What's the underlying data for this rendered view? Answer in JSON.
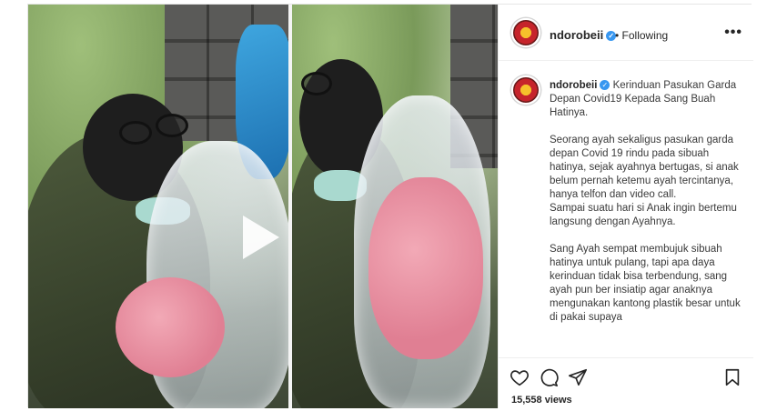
{
  "post": {
    "username": "ndorobeii",
    "follow_status": "• Following",
    "more_label": "•••",
    "caption": {
      "title": "Kerinduan Pasukan Garda Depan Covid19 Kepada Sang Buah Hatinya.",
      "paragraph1": "Seorang ayah sekaligus pasukan garda depan Covid 19 rindu pada sibuah hatinya, sejak ayahnya bertugas, si anak belum pernah ketemu ayah tercintanya, hanya telfon dan video call.",
      "paragraph2": "Sampai suatu hari si Anak ingin bertemu langsung dengan Ayahnya.",
      "paragraph3": "Sang Ayah sempat membujuk sibuah hatinya untuk pulang, tapi apa daya kerinduan tidak bisa terbendung, sang ayah pun ber insiatip agar anaknya mengunakan kantong plastik besar untuk di pakai supaya"
    },
    "views": "15,558 views"
  },
  "icons": {
    "verified": "verified-badge-icon",
    "like": "heart-icon",
    "comment": "comment-bubble-icon",
    "share": "paper-plane-icon",
    "save": "bookmark-icon",
    "play": "play-icon",
    "more": "more-dots-icon"
  },
  "colors": {
    "verified_blue": "#3897f0",
    "border": "#efefef",
    "text": "#262626"
  }
}
